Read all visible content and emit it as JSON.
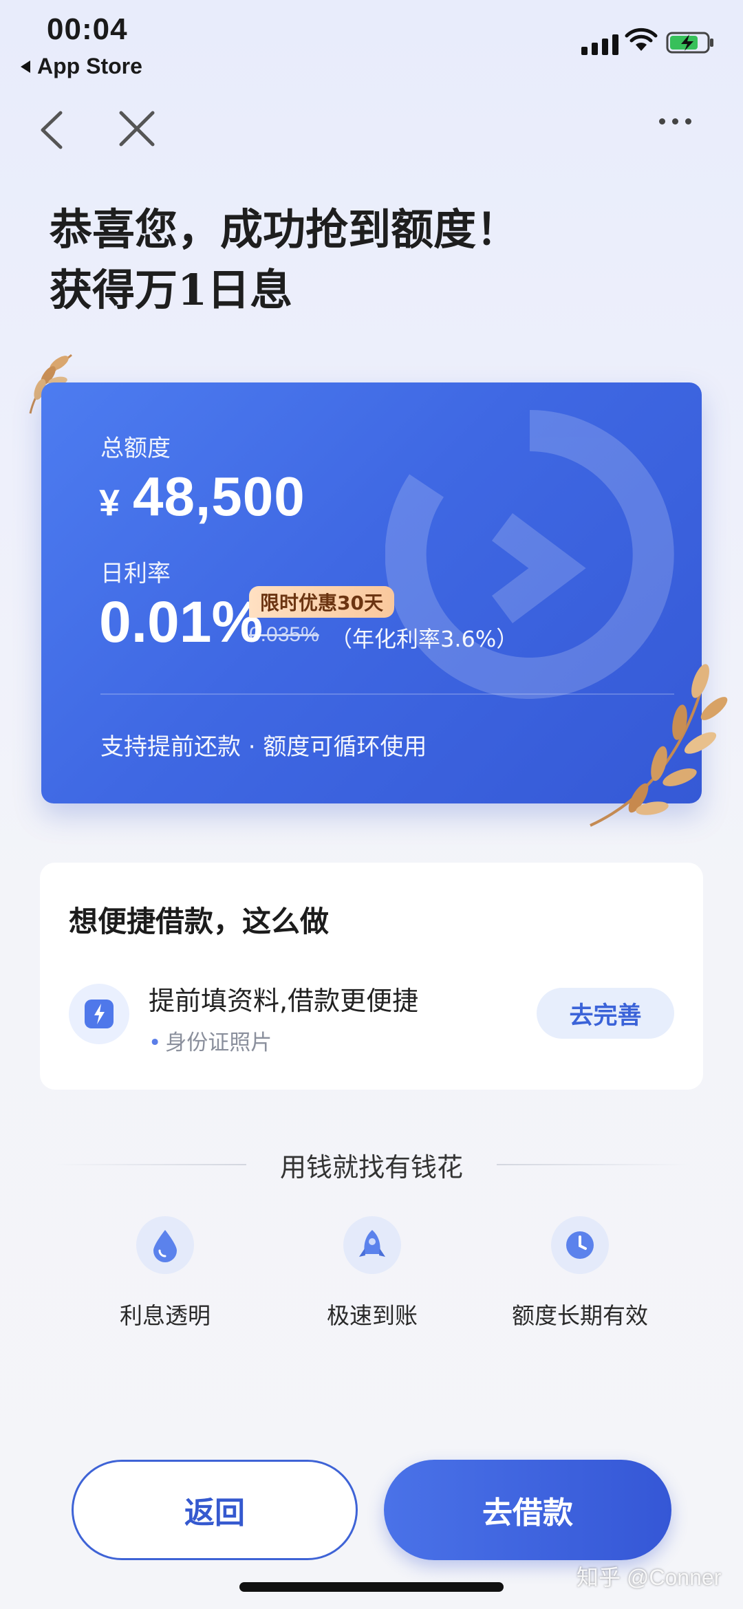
{
  "status_bar": {
    "time": "00:04",
    "back_app": "App Store"
  },
  "header": {
    "headline_line1": "恭喜您，成功抢到额度！",
    "headline_line2": "获得万1日息"
  },
  "credit_card": {
    "total_label": "总额度",
    "currency": "¥",
    "total_amount": "48,500",
    "rate_label": "日利率",
    "rate_value": "0.01%",
    "promo_badge": "限时优惠30天",
    "old_rate": "0.035%",
    "annual_rate": "（年化利率3.6%）",
    "features": "支持提前还款 · 额度可循环使用"
  },
  "tips": {
    "title": "想便捷借款，这么做",
    "main": "提前填资料,借款更便捷",
    "sub": "身份证照片",
    "button": "去完善"
  },
  "slogan": "用钱就找有钱花",
  "features": [
    {
      "label": "利息透明",
      "icon": "water-drop-icon"
    },
    {
      "label": "极速到账",
      "icon": "rocket-icon"
    },
    {
      "label": "额度长期有效",
      "icon": "clock-icon"
    }
  ],
  "buttons": {
    "return": "返回",
    "borrow": "去借款"
  },
  "watermark": "知乎 @Conner",
  "colors": {
    "accent": "#3f68e3",
    "badge": "#f9c89d",
    "laurel": "#d49b63"
  }
}
